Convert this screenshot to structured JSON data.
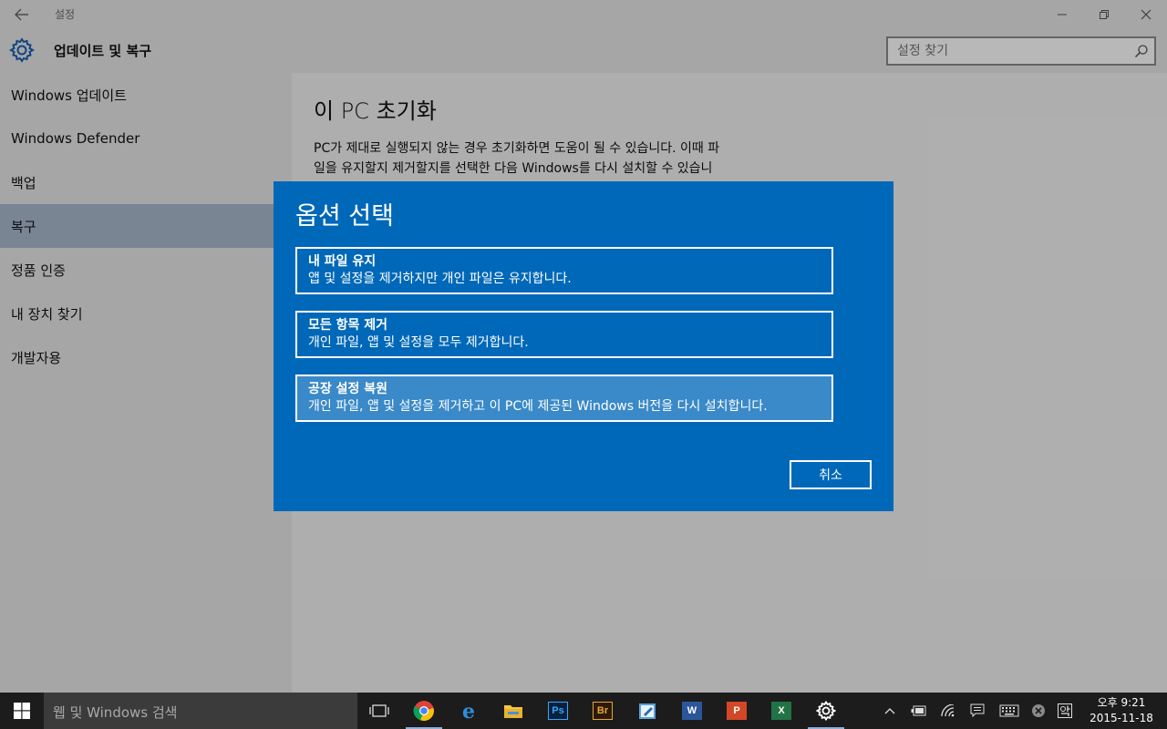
{
  "window": {
    "title": "설정",
    "controls": {
      "minimize": "─",
      "maximize": "❐",
      "close": "✕"
    }
  },
  "header": {
    "title": "업데이트 및 복구",
    "search_placeholder": "설정 찾기"
  },
  "sidebar": {
    "items": [
      {
        "label": "Windows 업데이트",
        "active": false
      },
      {
        "label": "Windows Defender",
        "active": false
      },
      {
        "label": "백업",
        "active": false
      },
      {
        "label": "복구",
        "active": true
      },
      {
        "label": "정품 인증",
        "active": false
      },
      {
        "label": "내 장치 찾기",
        "active": false
      },
      {
        "label": "개발자용",
        "active": false
      }
    ]
  },
  "content": {
    "title": "이 PC 초기화",
    "description": "PC가 제대로 실행되지 않는 경우 초기화하면 도움이 될 수 있습니다. 이때 파일을 유지할지 제거할지를 선택한 다음 Windows를 다시 설치할 수 있습니다."
  },
  "dialog": {
    "title": "옵션 선택",
    "options": [
      {
        "title": "내 파일 유지",
        "desc": "앱 및 설정을 제거하지만 개인 파일은 유지합니다."
      },
      {
        "title": "모든 항목 제거",
        "desc": "개인 파일, 앱 및 설정을 모두 제거합니다."
      },
      {
        "title": "공장 설정 복원",
        "desc": "개인 파일, 앱 및 설정을 제거하고 이 PC에 제공된 Windows 버전을 다시 설치합니다."
      }
    ],
    "cancel_label": "취소"
  },
  "taskbar": {
    "search_placeholder": "웹 및 Windows 검색",
    "apps": [
      "task-view",
      "chrome",
      "edge",
      "file-explorer",
      "photoshop",
      "bridge",
      "notepad-app",
      "word",
      "powerpoint",
      "excel",
      "settings"
    ],
    "app_badges": {
      "photoshop": "Ps",
      "bridge": "Br",
      "word": "W",
      "powerpoint": "P",
      "excel": "X"
    },
    "clock": {
      "time": "오후 9:21",
      "date": "2015-11-18"
    }
  },
  "colors": {
    "accent": "#0068b8",
    "sidebar_active": "#aab9cd",
    "taskbar": "#1c1c1c"
  }
}
